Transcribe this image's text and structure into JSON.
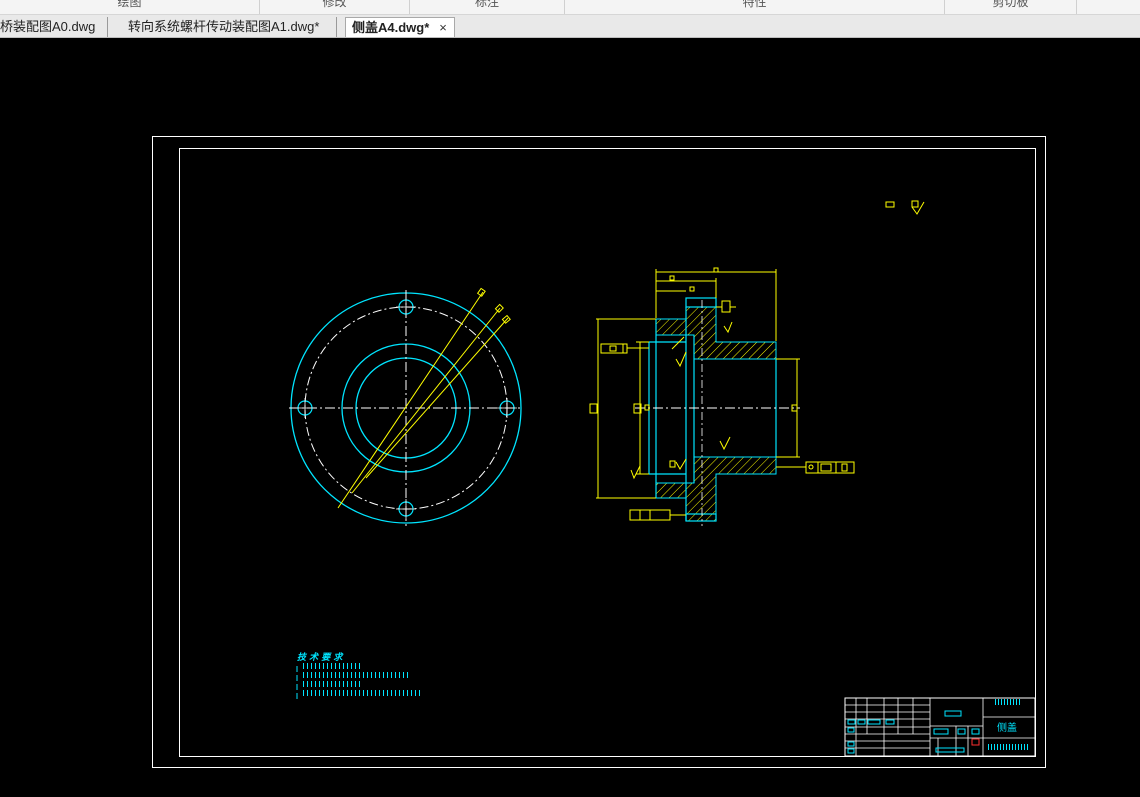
{
  "ribbon": {
    "groups": [
      {
        "label": "绘图"
      },
      {
        "label": "修改"
      },
      {
        "label": "标注"
      },
      {
        "label": "特性"
      },
      {
        "label": "剪切板"
      }
    ]
  },
  "tabs": [
    {
      "label": "桥装配图A0.dwg",
      "active": false
    },
    {
      "label": "转向系统螺杆传动装配图A1.dwg*",
      "active": false
    },
    {
      "label": "侧盖A4.dwg*",
      "active": true,
      "close": "×"
    }
  ],
  "drawing": {
    "tech_requirements_title": "技 术 要 求",
    "title_block_part_name": "侧盖"
  },
  "colors": {
    "background": "#000000",
    "frame": "#ffffff",
    "outline": "#00e5ff",
    "dimension": "#ffff00",
    "hatch": "#ffff00",
    "stamp_red": "#ff3030"
  },
  "icons": {
    "close": "close-icon"
  }
}
